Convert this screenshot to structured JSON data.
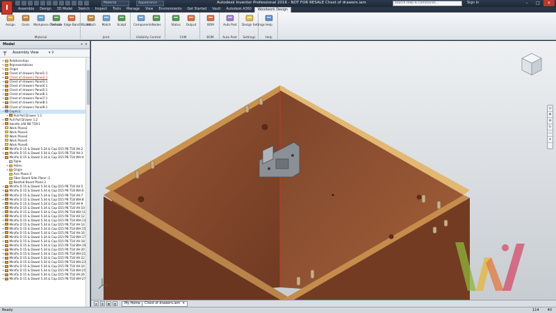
{
  "app": {
    "logo_letter": "I",
    "title": "Autodesk Inventor Professional 2016 - NOT FOR RESALE     Chest of drawers.iam",
    "material_field": "Material",
    "appearance_field": "Appearance",
    "search_placeholder": "Search Help & Commands...",
    "sign_in": "Sign In",
    "win_min": "–",
    "win_max": "□",
    "win_close": "✕"
  },
  "tabs": [
    {
      "label": "Assemble",
      "active": false
    },
    {
      "label": "Design",
      "active": false
    },
    {
      "label": "3D Model",
      "active": false
    },
    {
      "label": "Sketch",
      "active": false
    },
    {
      "label": "Inspect",
      "active": false
    },
    {
      "label": "Tools",
      "active": false
    },
    {
      "label": "Manage",
      "active": false
    },
    {
      "label": "View",
      "active": false
    },
    {
      "label": "Environments",
      "active": false
    },
    {
      "label": "Get Started",
      "active": false
    },
    {
      "label": "Vault",
      "active": false
    },
    {
      "label": "Autodesk A360",
      "active": false
    },
    {
      "label": "Woodwork Design",
      "active": true
    }
  ],
  "ribbon": {
    "groups": [
      {
        "label": "Material",
        "buttons": [
          "Assign",
          "Grain",
          "Workpiece Oversize",
          "Refresh",
          "Edge Band Wizard"
        ]
      },
      {
        "label": "Joint",
        "buttons": [
          "Attach",
          "Match",
          "Scalpt"
        ]
      },
      {
        "label": "Visibility Control",
        "buttons": [
          "Components",
          "Nodes"
        ]
      },
      {
        "label": "CAM",
        "buttons": [
          "Status",
          "Output"
        ]
      },
      {
        "label": "BOM",
        "buttons": [
          "BOM"
        ]
      },
      {
        "label": "Auto Post",
        "buttons": [
          "Auto Post"
        ]
      },
      {
        "label": "Settings",
        "buttons": [
          "Design Settings"
        ]
      },
      {
        "label": "Help",
        "buttons": [
          "Help"
        ]
      }
    ]
  },
  "browser": {
    "title": "Model",
    "tool_plus": "+",
    "tool_close": "×",
    "view_label": "Assembly View",
    "view_icons": "▾  ⚲",
    "rows": [
      {
        "label": "Relationships",
        "icon": "folder",
        "exp": "+",
        "indent": 1
      },
      {
        "label": "Representations",
        "icon": "folder",
        "exp": "+",
        "indent": 1
      },
      {
        "label": "Origin",
        "icon": "folder",
        "exp": "+",
        "indent": 1
      },
      {
        "label": "Chest of drawers Panel1:1",
        "icon": "part",
        "exp": "+",
        "indent": 1
      },
      {
        "label": "Chest of drawers Panel2:1",
        "icon": "part",
        "exp": "+",
        "indent": 1,
        "state": "err"
      },
      {
        "label": "Chest of drawers Panel3:1",
        "icon": "part",
        "exp": "+",
        "indent": 1
      },
      {
        "label": "Chest of drawers Panel4:1",
        "icon": "part",
        "exp": "+",
        "indent": 1
      },
      {
        "label": "Chest of drawers Panel5:1",
        "icon": "part",
        "exp": "+",
        "indent": 1
      },
      {
        "label": "Chest of drawers Panel6:1",
        "icon": "part",
        "exp": "+",
        "indent": 1
      },
      {
        "label": "Chest of drawers Panel7:1",
        "icon": "part",
        "exp": "+",
        "indent": 1
      },
      {
        "label": "Chest of drawers Panel8:1",
        "icon": "part",
        "exp": "+",
        "indent": 1
      },
      {
        "label": "Chest of drawers Panel9:1",
        "icon": "part",
        "exp": "+",
        "indent": 1
      },
      {
        "label": "Cepm:1",
        "icon": "asm",
        "exp": "−",
        "indent": 1,
        "state": "sel"
      },
      {
        "label": "Pull Pull Drawer 1:1",
        "icon": "part",
        "exp": "+",
        "indent": 2
      },
      {
        "label": "Pull Pull Drawer 1:2",
        "icon": "part",
        "exp": "+",
        "indent": 1
      },
      {
        "label": "Handle LA8 N8 T18:1",
        "icon": "part",
        "exp": "+",
        "indent": 1
      },
      {
        "label": "Work Plane2",
        "icon": "plane",
        "exp": "",
        "indent": 1
      },
      {
        "label": "Work Plane3",
        "icon": "plane",
        "exp": "",
        "indent": 1
      },
      {
        "label": "Work Plane4",
        "icon": "plane",
        "exp": "",
        "indent": 1
      },
      {
        "label": "Work Plane5",
        "icon": "plane",
        "exp": "",
        "indent": 1
      },
      {
        "label": "Work Plane6",
        "icon": "plane",
        "exp": "",
        "indent": 1
      },
      {
        "label": "Minifix D 15 & Dowel 5.34 & Cap D15 PB T18 VH:2",
        "icon": "part",
        "exp": "+",
        "indent": 1
      },
      {
        "label": "Minifix D 15 & Dowel 5.34 & Cap D15 PB T18 VH:3",
        "icon": "part",
        "exp": "+",
        "indent": 1
      },
      {
        "label": "Minifix D 15 & Dowel 5.34 & Cap D15 PB T18 WH:4",
        "icon": "part",
        "exp": "−",
        "indent": 1
      },
      {
        "label": "Table",
        "icon": "table",
        "exp": "",
        "indent": 2
      },
      {
        "label": "Holes",
        "icon": "folder",
        "exp": "+",
        "indent": 2
      },
      {
        "label": "Origin",
        "icon": "folder",
        "exp": "+",
        "indent": 2
      },
      {
        "label": "Axis Plane:3",
        "icon": "plane",
        "exp": "",
        "indent": 2
      },
      {
        "label": "Fiber Board Side Plane :3",
        "icon": "plane",
        "exp": "",
        "indent": 2
      },
      {
        "label": "Nestled Board Plane:3",
        "icon": "plane",
        "exp": "",
        "indent": 2
      },
      {
        "label": "Minifix D 15 & Dowel 5.34 & Cap D15 PB T18 VH:5",
        "icon": "part",
        "exp": "+",
        "indent": 1
      },
      {
        "label": "Minifix D 15 & Dowel 5.34 & Cap D15 PB T18 WH:6",
        "icon": "part",
        "exp": "+",
        "indent": 1
      },
      {
        "label": "Minifix D 15 & Dowel 5.34 & Cap D15 PB T18 VH:7",
        "icon": "part",
        "exp": "+",
        "indent": 1
      },
      {
        "label": "Minifix D 15 & Dowel 5.34 & Cap D15 PB T18 WH:8",
        "icon": "part",
        "exp": "+",
        "indent": 1
      },
      {
        "label": "Minifix D 15 & Dowel 5.34 & Cap D15 PB T18 VH:9",
        "icon": "part",
        "exp": "+",
        "indent": 1
      },
      {
        "label": "Minifix D 15 & Dowel 5.34 & Cap D15 PB T18 VH:10",
        "icon": "part",
        "exp": "+",
        "indent": 1
      },
      {
        "label": "Minifix D 15 & Dowel 5.34 & Cap D15 PB T18 WH:11",
        "icon": "part",
        "exp": "+",
        "indent": 1
      },
      {
        "label": "Minifix D 15 & Dowel 5.34 & Cap D15 PB T18 VH:12",
        "icon": "part",
        "exp": "+",
        "indent": 1
      },
      {
        "label": "Minifix D 15 & Dowel 5.34 & Cap D15 PB T18 WH:13",
        "icon": "part",
        "exp": "+",
        "indent": 1
      },
      {
        "label": "Minifix D 15 & Dowel 5.34 & Cap D15 PB T18 VH:14",
        "icon": "part",
        "exp": "+",
        "indent": 1
      },
      {
        "label": "Minifix D 15 & Dowel 5.34 & Cap D15 PB T18 WH:15",
        "icon": "part",
        "exp": "+",
        "indent": 1
      },
      {
        "label": "Minifix D 15 & Dowel 5.34 & Cap D15 PB T18 VH:16",
        "icon": "part",
        "exp": "+",
        "indent": 1
      },
      {
        "label": "Minifix D 15 & Dowel 5.34 & Cap D15 PB T18 WH:17",
        "icon": "part",
        "exp": "+",
        "indent": 1
      },
      {
        "label": "Minifix D 15 & Dowel 5.34 & Cap D15 PB T18 VH:18",
        "icon": "part",
        "exp": "+",
        "indent": 1
      },
      {
        "label": "Minifix D 15 & Dowel 5.34 & Cap D15 PB T18 WH:19",
        "icon": "part",
        "exp": "+",
        "indent": 1
      },
      {
        "label": "Minifix D 15 & Dowel 5.34 & Cap D15 PB T18 VH:20",
        "icon": "part",
        "exp": "+",
        "indent": 1
      },
      {
        "label": "Minifix D 15 & Dowel 5.34 & Cap D15 PB T18 WH:21",
        "icon": "part",
        "exp": "+",
        "indent": 1
      },
      {
        "label": "Minifix D 15 & Dowel 5.34 & Cap D15 PB T18 VH:22",
        "icon": "part",
        "exp": "+",
        "indent": 1
      },
      {
        "label": "Minifix D 15 & Dowel 5.34 & Cap D15 PB T18 WH:23",
        "icon": "part",
        "exp": "+",
        "indent": 1
      },
      {
        "label": "Minifix D 15 & Dowel 5.34 & Cap D15 PB T18 VH:24",
        "icon": "part",
        "exp": "+",
        "indent": 1
      },
      {
        "label": "Minifix D 15 & Dowel 5.34 & Cap D15 PB T18 WH:25",
        "icon": "part",
        "exp": "+",
        "indent": 1
      },
      {
        "label": "Minifix D 15 & Dowel 5.34 & Cap D15 PB T18 VH:26",
        "icon": "part",
        "exp": "+",
        "indent": 1
      },
      {
        "label": "Minifix D 15 & Dowel 5.34 & Cap D15 PB T18 WH:27",
        "icon": "part",
        "exp": "+",
        "indent": 1
      }
    ]
  },
  "doc_tabs": {
    "controls": [
      "▤",
      "▥",
      "▦",
      "▧"
    ],
    "tabs": [
      {
        "label": "My Home",
        "active": false
      },
      {
        "label": "Chest of drawers.iam",
        "active": true,
        "close": "×"
      }
    ]
  },
  "status": {
    "text": "Ready",
    "count_a": "114",
    "count_b": "40"
  },
  "colors": {
    "wood_face": "#8a4b2f",
    "wood_edge": "#d9b06b",
    "accent": "#c8392b"
  }
}
